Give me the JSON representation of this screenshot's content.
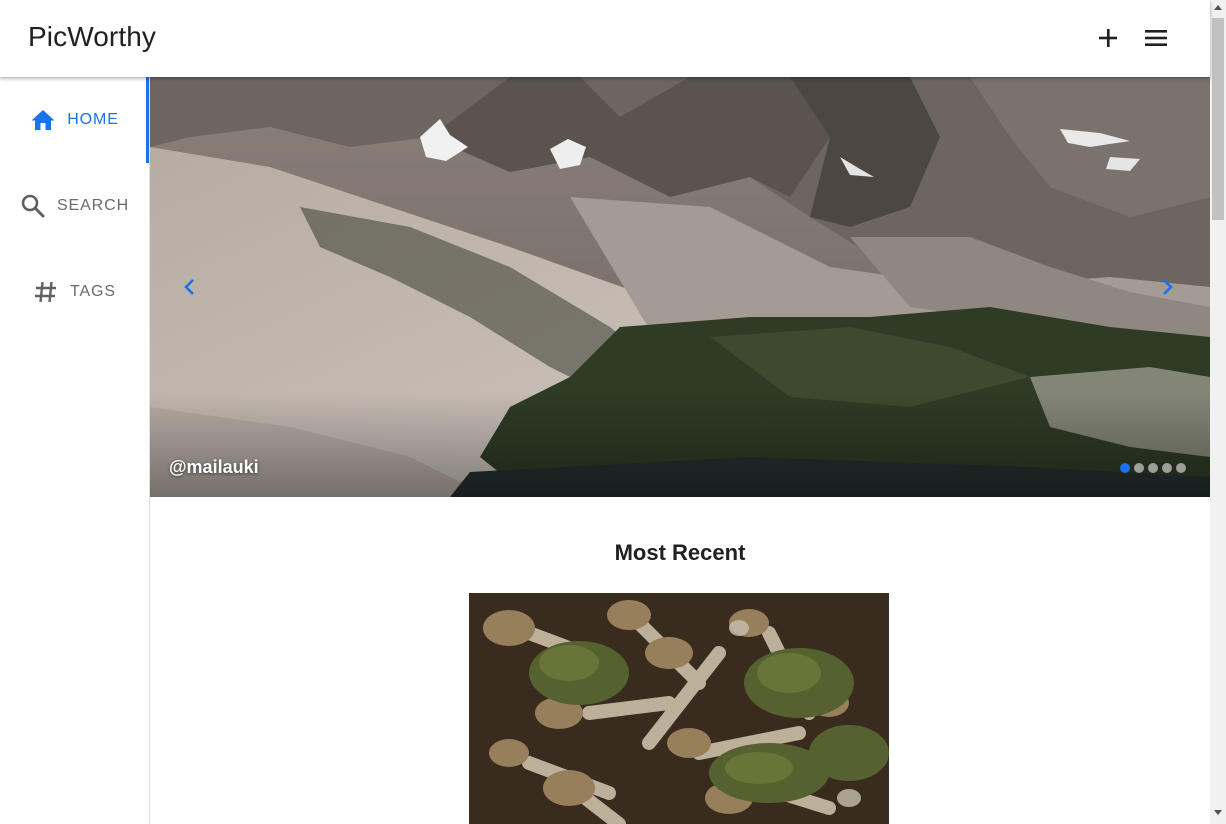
{
  "app": {
    "title": "PicWorthy"
  },
  "toolbar": {
    "add_icon": "plus-icon",
    "menu_icon": "hamburger-menu-icon"
  },
  "sidebar": {
    "items": [
      {
        "label": "HOME",
        "icon": "home-icon",
        "active": true
      },
      {
        "label": "SEARCH",
        "icon": "search-icon",
        "active": false
      },
      {
        "label": "TAGS",
        "icon": "hash-icon",
        "active": false
      }
    ]
  },
  "carousel": {
    "credit": "@mailauki",
    "slide_count": 5,
    "active_slide": 1,
    "prev_icon": "chevron-left-icon",
    "next_icon": "chevron-right-icon"
  },
  "main": {
    "section_title": "Most Recent"
  },
  "colors": {
    "accent": "#1a73e8",
    "text": "#212121",
    "muted": "#6b6b6b"
  }
}
